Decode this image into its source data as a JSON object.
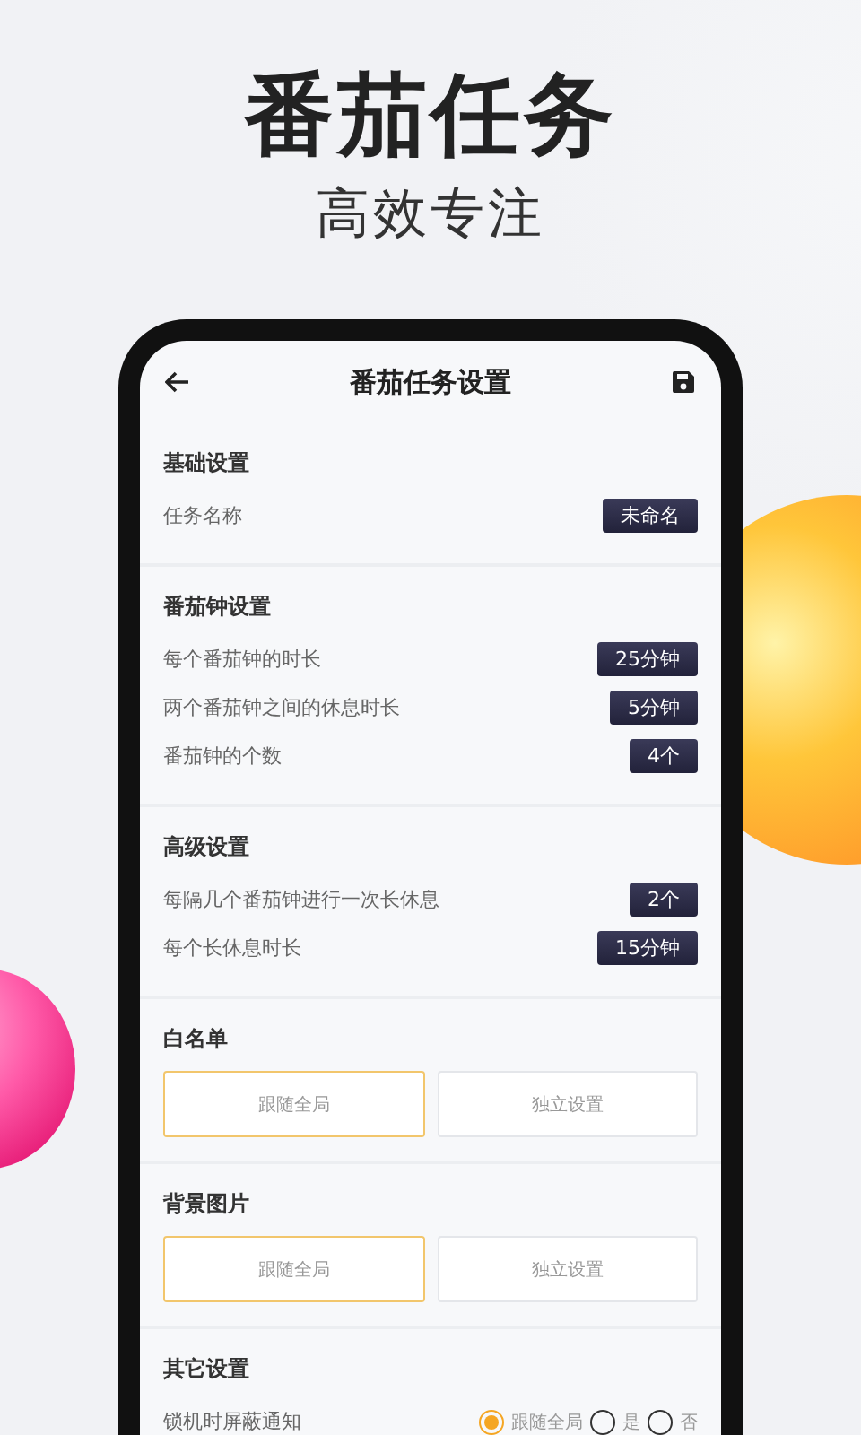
{
  "hero": {
    "title": "番茄任务",
    "subtitle": "高效专注"
  },
  "screen": {
    "title": "番茄任务设置"
  },
  "sections": [
    {
      "title": "基础设置",
      "kind": "values",
      "rows": [
        {
          "label": "任务名称",
          "value": "未命名"
        }
      ]
    },
    {
      "title": "番茄钟设置",
      "kind": "values",
      "rows": [
        {
          "label": "每个番茄钟的时长",
          "value": "25分钟"
        },
        {
          "label": "两个番茄钟之间的休息时长",
          "value": "5分钟"
        },
        {
          "label": "番茄钟的个数",
          "value": "4个"
        }
      ]
    },
    {
      "title": "高级设置",
      "kind": "values",
      "rows": [
        {
          "label": "每隔几个番茄钟进行一次长休息",
          "value": "2个"
        },
        {
          "label": "每个长休息时长",
          "value": "15分钟"
        }
      ]
    },
    {
      "title": "白名单",
      "kind": "choice",
      "options": [
        {
          "label": "跟随全局",
          "selected": true
        },
        {
          "label": "独立设置",
          "selected": false
        }
      ]
    },
    {
      "title": "背景图片",
      "kind": "choice",
      "options": [
        {
          "label": "跟随全局",
          "selected": true
        },
        {
          "label": "独立设置",
          "selected": false
        }
      ]
    },
    {
      "title": "其它设置",
      "kind": "radios",
      "rows": [
        {
          "label": "锁机时屏蔽通知",
          "options": [
            {
              "label": "跟随全局",
              "selected": true
            },
            {
              "label": "是",
              "selected": false
            },
            {
              "label": "否",
              "selected": false
            }
          ]
        }
      ]
    }
  ]
}
